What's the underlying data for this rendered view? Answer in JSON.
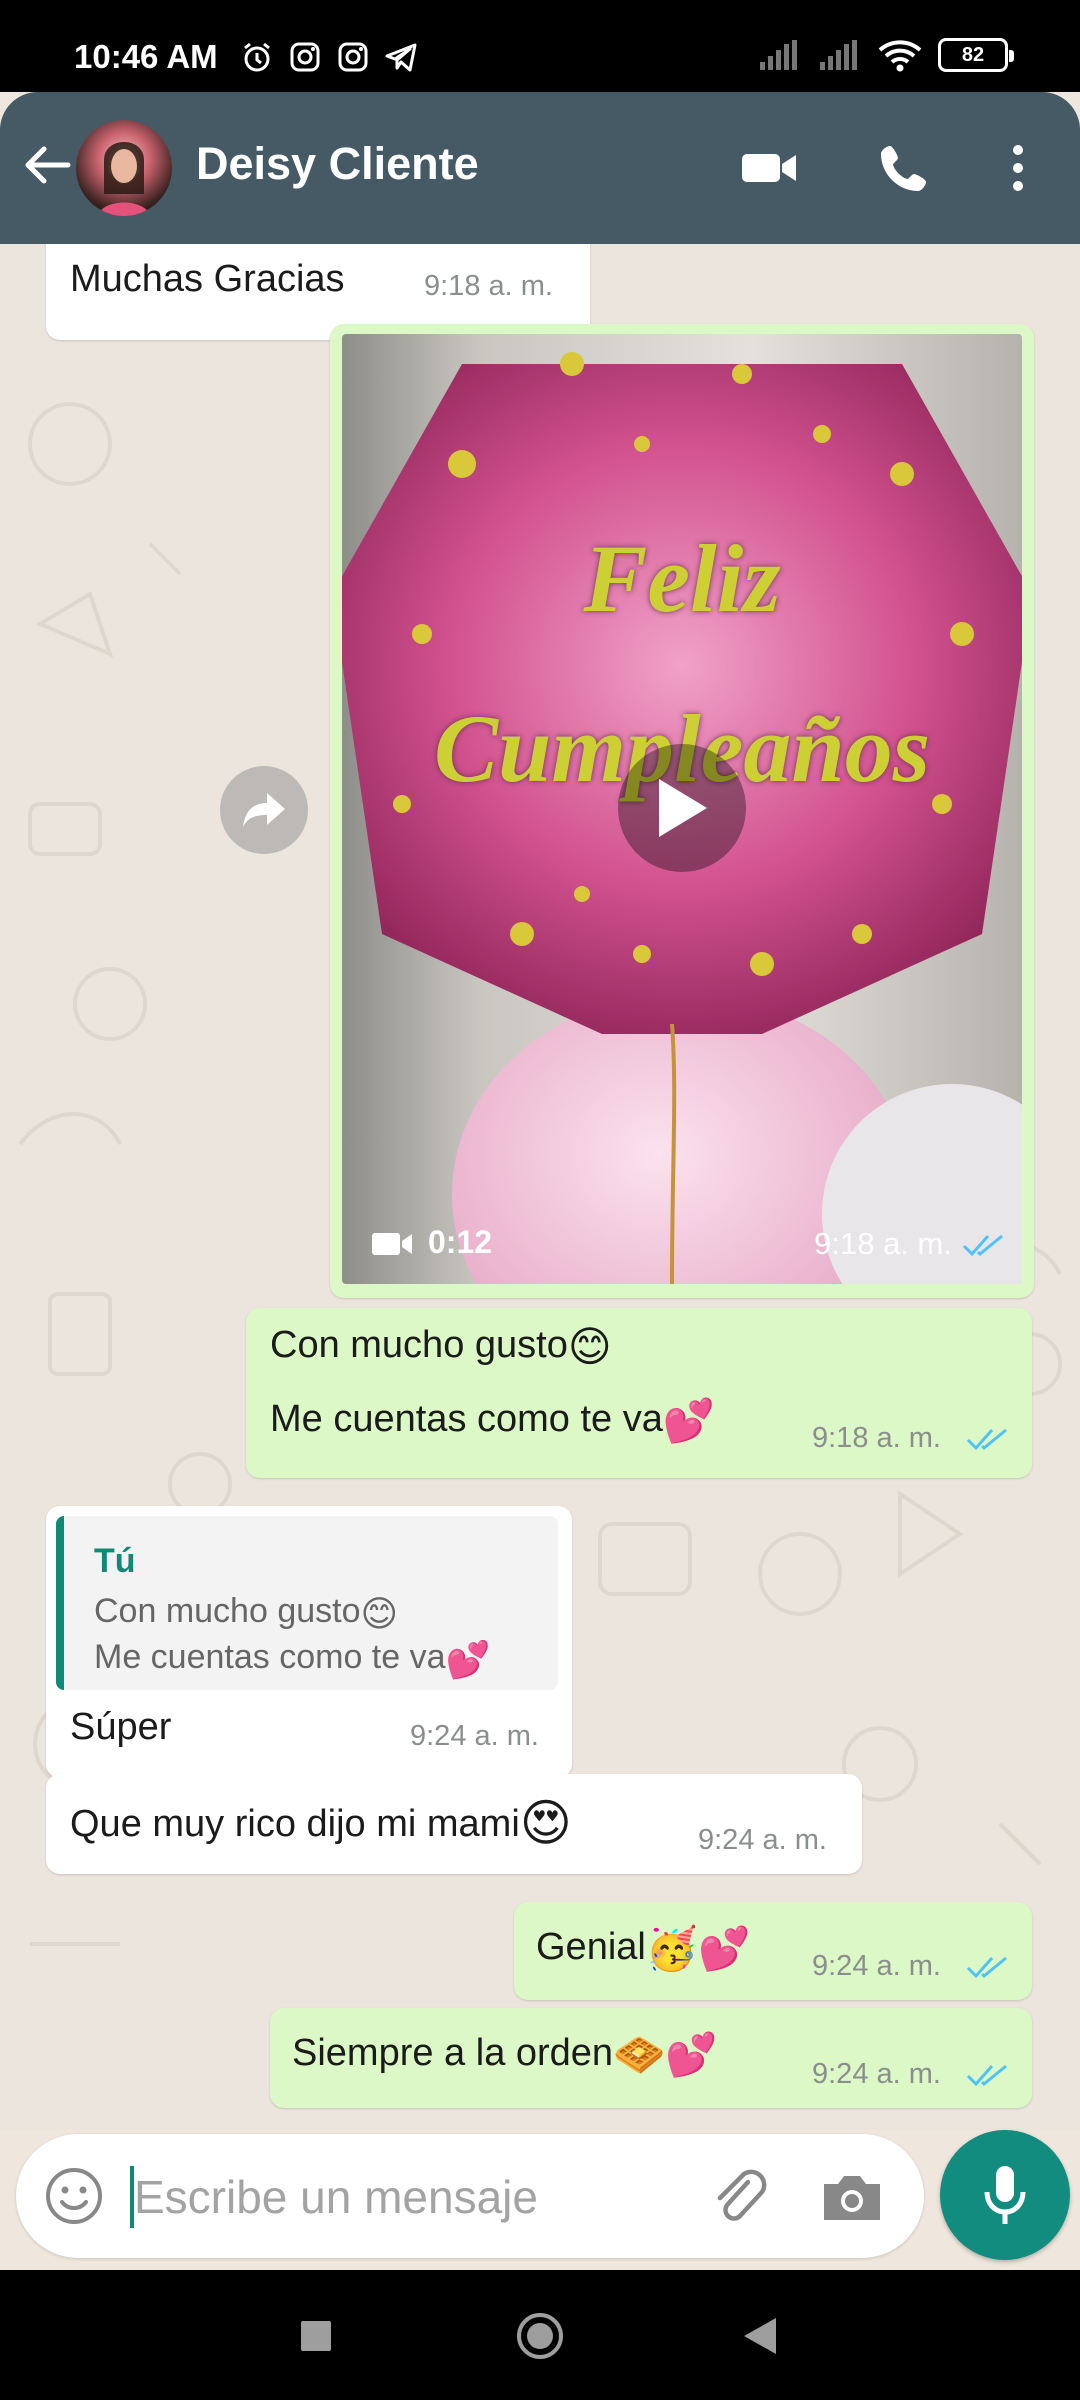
{
  "status_bar": {
    "time": "10:46 AM",
    "battery": "82",
    "icons": [
      "alarm-icon",
      "instagram-icon",
      "instagram-icon",
      "telegram-icon",
      "signal-icon",
      "signal-icon",
      "wifi-icon",
      "battery-icon"
    ]
  },
  "header": {
    "contact_name": "Deisy Cliente",
    "actions": [
      "video-call-icon",
      "phone-icon",
      "more-options-icon"
    ],
    "bg_color": "#455a64"
  },
  "messages": [
    {
      "direction": "in",
      "text": "Muchas Gracias",
      "time": "9:18 a. m."
    },
    {
      "direction": "out",
      "type": "video",
      "overlay_text": "Feliz Cumpleaños",
      "duration": "0:12",
      "time": "9:18 a. m.",
      "status": "read"
    },
    {
      "direction": "out",
      "line1": "Con mucho gusto",
      "line1_emoji": "😊",
      "line2": "Me cuentas como te va",
      "line2_emoji": "💕",
      "time": "9:18 a. m.",
      "status": "read"
    },
    {
      "direction": "in",
      "quote_author": "Tú",
      "quote_line1": "Con mucho gusto",
      "quote_line1_emoji": "😊",
      "quote_line2": "Me cuentas como te va",
      "quote_line2_emoji": "💕",
      "text": "Súper",
      "time": "9:24 a. m."
    },
    {
      "direction": "in",
      "text": "Que muy rico dijo mi mami",
      "emoji": "😍",
      "time": "9:24 a. m."
    },
    {
      "direction": "out",
      "text": "Genial",
      "emoji": "🥳💕",
      "time": "9:24 a. m.",
      "status": "read"
    },
    {
      "direction": "out",
      "text": "Siempre a la orden",
      "emoji": "🧇💕",
      "time": "9:24 a. m.",
      "status": "read"
    }
  ],
  "input": {
    "placeholder": "Escribe un mensaje",
    "value": ""
  },
  "colors": {
    "accent": "#128c7e",
    "outgoing_bubble": "#dcf8c6",
    "incoming_bubble": "#ffffff",
    "read_ticks": "#4fc3f7",
    "quote_accent": "#0f8a74"
  },
  "nav_bar": [
    "recents-icon",
    "home-icon",
    "back-icon"
  ]
}
